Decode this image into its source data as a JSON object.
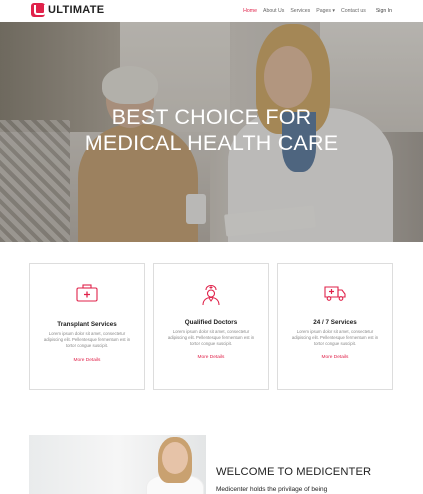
{
  "brand": {
    "name": "ULTIMATE",
    "accent": "#e0224a"
  },
  "nav": {
    "items": [
      {
        "label": "Home",
        "active": true
      },
      {
        "label": "About Us",
        "active": false
      },
      {
        "label": "Services",
        "active": false
      },
      {
        "label": "Pages",
        "active": false,
        "dropdown": true
      },
      {
        "label": "Contact us",
        "active": false
      }
    ],
    "signin": "Sign In"
  },
  "hero": {
    "line1": "BEST CHOICE FOR",
    "line2": "MEDICAL HEALTH CARE"
  },
  "services": [
    {
      "icon": "first-aid-kit-icon",
      "title": "Transplant Services",
      "desc": "Lorem ipsum dolor sit amet, consectetur adipiscing elit. Pellentesque fermentum est in tortor congue suscipit.",
      "link": "More Details"
    },
    {
      "icon": "nurse-icon",
      "title": "Qualified Doctors",
      "desc": "Lorem ipsum dolor sit amet, consectetur adipiscing elit. Pellentesque fermentum est in tortor congue suscipit.",
      "link": "More Details"
    },
    {
      "icon": "ambulance-icon",
      "title": "24 / 7 Services",
      "desc": "Lorem ipsum dolor sit amet, consectetur adipiscing elit. Pellentesque fermentum est in tortor congue suscipit.",
      "link": "More Details"
    }
  ],
  "welcome": {
    "title": "WELCOME TO MEDICENTER",
    "subline": "Medicenter holds  the privilage of being"
  }
}
